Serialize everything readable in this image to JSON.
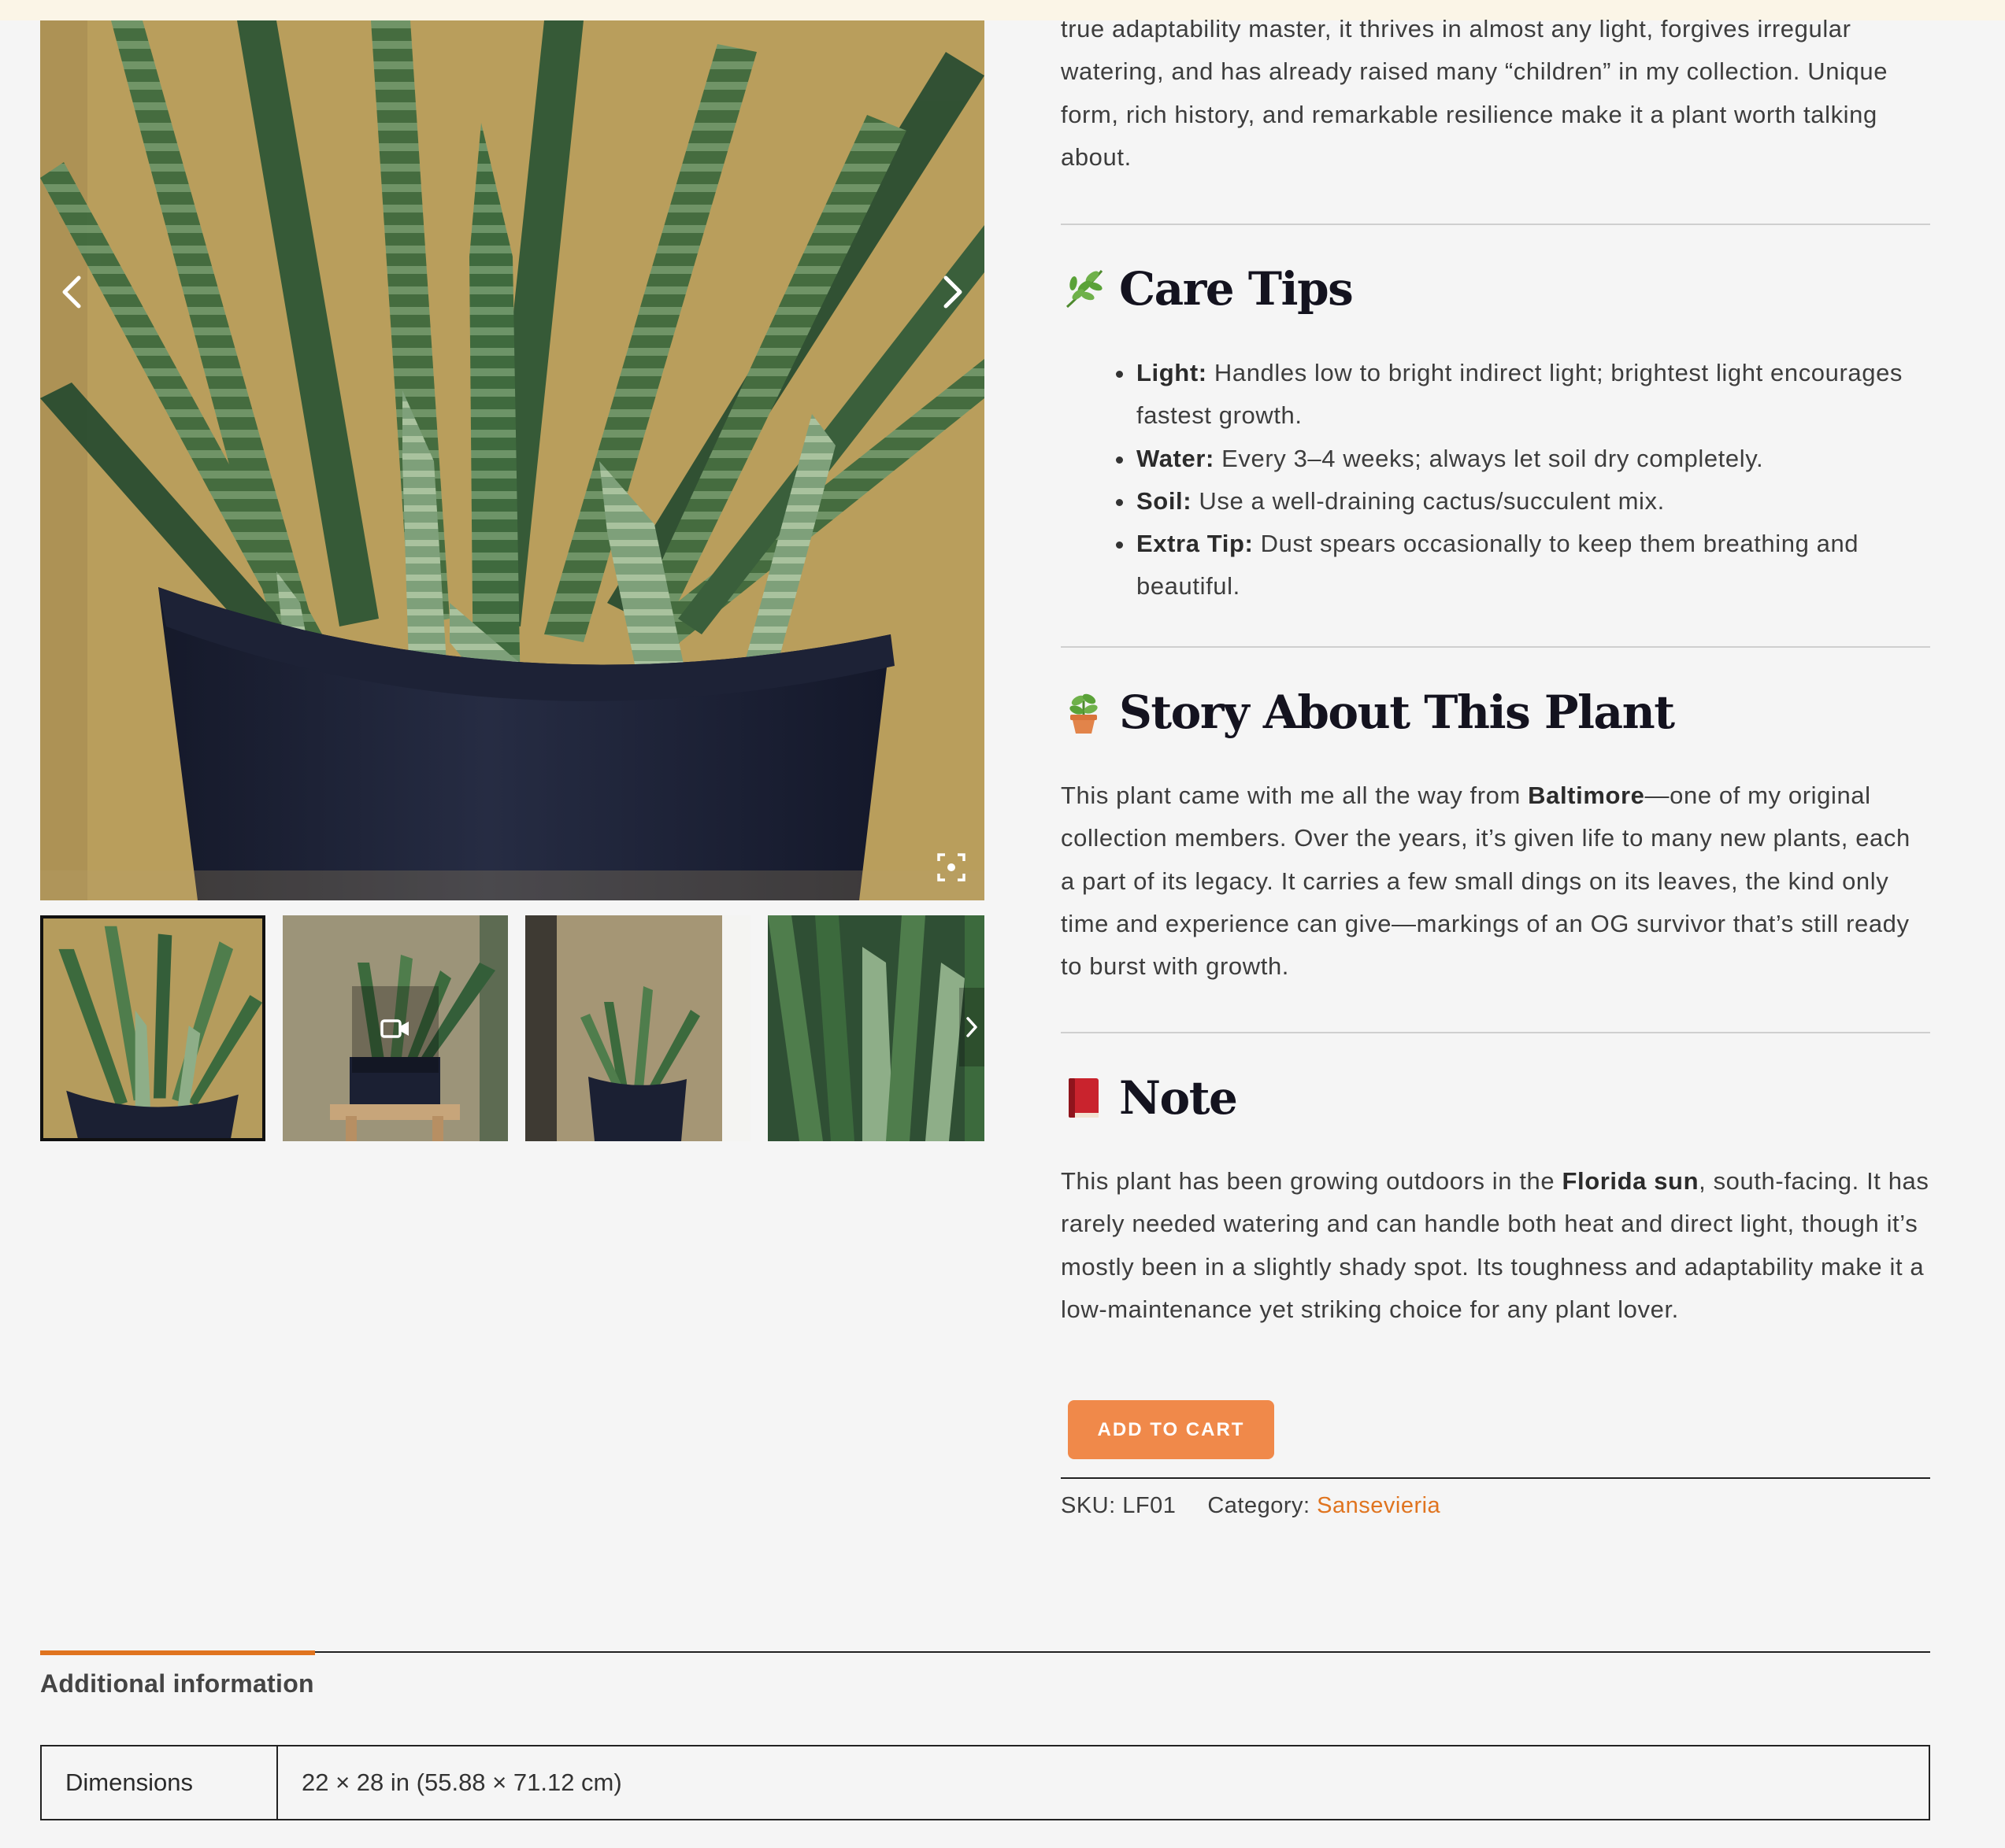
{
  "gallery": {
    "main_image_alt": "Sansevieria cylindrica in black pot",
    "thumbnails": [
      {
        "type": "image",
        "active": true
      },
      {
        "type": "video",
        "active": false
      },
      {
        "type": "image",
        "active": false
      },
      {
        "type": "image",
        "active": false
      }
    ],
    "icons": {
      "prev": "chevron-left-icon",
      "next": "chevron-right-icon",
      "zoom": "zoom-icon",
      "video": "video-camera-icon"
    }
  },
  "description": {
    "intro_text": "true adaptability master, it thrives in almost any light, forgives irregular watering, and has already raised many “children” in my collection. Unique form, rich history, and remarkable resilience make it a plant worth talking about.",
    "care_tips": {
      "title": "Care Tips",
      "emoji": "herb",
      "items": [
        {
          "label": "Light:",
          "text": "Handles low to bright indirect light; brightest light encourages fastest growth."
        },
        {
          "label": "Water:",
          "text": "Every 3–4 weeks; always let soil dry completely."
        },
        {
          "label": "Soil:",
          "text": "Use a well-draining cactus/succulent mix."
        },
        {
          "label": "Extra Tip:",
          "text": "Dust spears occasionally to keep them breathing and beautiful."
        }
      ]
    },
    "story": {
      "title": "Story About This Plant",
      "emoji": "potted-plant",
      "before": "This plant came with me all the way from ",
      "bold": "Baltimore",
      "after": "—one of my original collection members. Over the years, it’s given life to many new plants, each a part of its legacy. It carries a few small dings on its leaves, the kind only time and experience can give—markings of an OG survivor that’s still ready to burst with growth."
    },
    "note": {
      "title": "Note",
      "emoji": "red-book",
      "before": "This plant has been growing outdoors in the ",
      "bold": "Florida sun",
      "after": ", south-facing. It has rarely needed watering and can handle both heat and direct light, though it’s mostly been in a slightly shady spot. Its toughness and adaptability make it a low-maintenance yet striking choice for any plant lover."
    }
  },
  "cart": {
    "button_label": "ADD TO CART"
  },
  "product_meta": {
    "sku_label": "SKU:",
    "sku_value": "LF01",
    "category_label": "Category:",
    "category_value": "Sansevieria"
  },
  "tabs": {
    "active_label": "Additional information"
  },
  "attributes": [
    {
      "name": "Dimensions",
      "value": "22 × 28 in (55.88 × 71.12 cm)"
    }
  ],
  "colors": {
    "accent": "#f0894a",
    "link": "#e0741f",
    "background": "#f5f5f5",
    "heading": "#14131f"
  }
}
